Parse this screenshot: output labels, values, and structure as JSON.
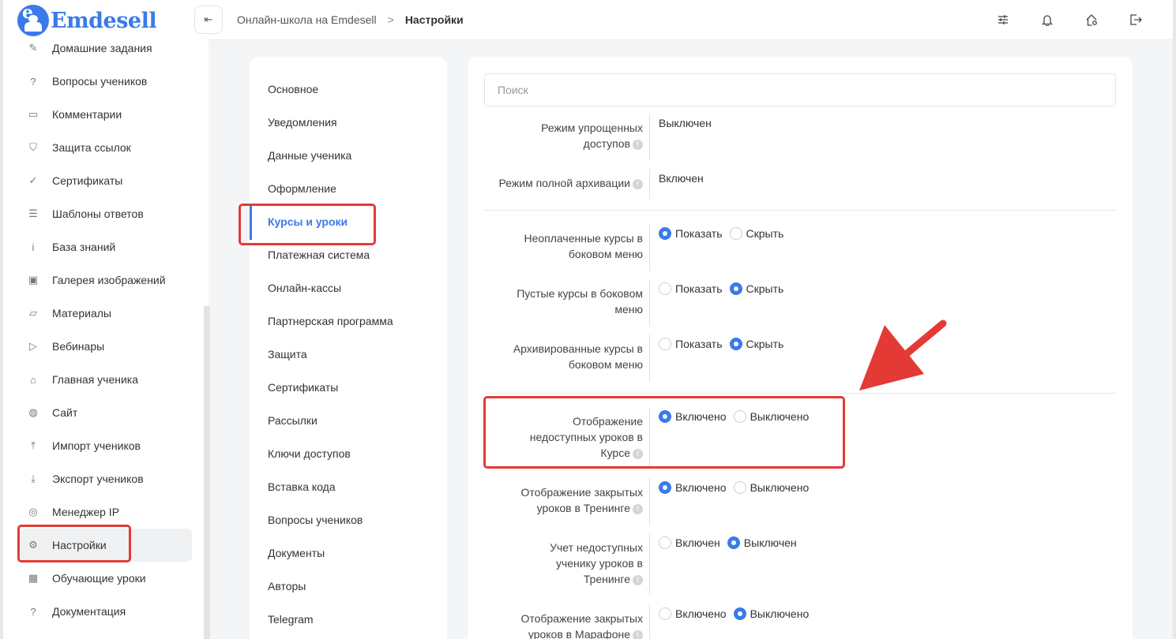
{
  "brand": {
    "letter": "e",
    "name": "Emdesell"
  },
  "sidebar": {
    "items": [
      {
        "label": "Домашние задания",
        "icon": "pencil-icon",
        "glyph": "✎"
      },
      {
        "label": "Вопросы учеников",
        "icon": "question-circle-icon",
        "glyph": "?"
      },
      {
        "label": "Комментарии",
        "icon": "comment-icon",
        "glyph": "▭"
      },
      {
        "label": "Защита ссылок",
        "icon": "shield-icon",
        "glyph": "⛉"
      },
      {
        "label": "Сертификаты",
        "icon": "badge-check-icon",
        "glyph": "✓"
      },
      {
        "label": "Шаблоны ответов",
        "icon": "list-icon",
        "glyph": "☰"
      },
      {
        "label": "База знаний",
        "icon": "info-circle-icon",
        "glyph": "i"
      },
      {
        "label": "Галерея изображений",
        "icon": "image-icon",
        "glyph": "▣"
      },
      {
        "label": "Материалы",
        "icon": "box-icon",
        "glyph": "▱"
      },
      {
        "label": "Вебинары",
        "icon": "play-icon",
        "glyph": "▷"
      },
      {
        "label": "Главная ученика",
        "icon": "home-gear-icon",
        "glyph": "⌂"
      },
      {
        "label": "Сайт",
        "icon": "globe-icon",
        "glyph": "◍"
      },
      {
        "label": "Импорт учеников",
        "icon": "upload-icon",
        "glyph": "⤒"
      },
      {
        "label": "Экспорт учеников",
        "icon": "download-icon",
        "glyph": "⤓"
      },
      {
        "label": "Менеджер IP",
        "icon": "target-icon",
        "glyph": "◎"
      },
      {
        "label": "Настройки",
        "icon": "gear-icon",
        "glyph": "⚙"
      },
      {
        "label": "Обучающие уроки",
        "icon": "film-icon",
        "glyph": "▦"
      },
      {
        "label": "Документация",
        "icon": "help-square-icon",
        "glyph": "?"
      }
    ]
  },
  "topbar": {
    "collapse_glyph": "⇤",
    "crumb_root": "Онлайн-школа на Emdesell",
    "crumb_sep": ">",
    "crumb_current": "Настройки",
    "icons": [
      "sliders-icon",
      "bell-icon",
      "home-settings-icon",
      "logout-icon"
    ]
  },
  "settings_menu": {
    "items": [
      "Основное",
      "Уведомления",
      "Данные ученика",
      "Оформление",
      "Курсы и уроки",
      "Платежная система",
      "Онлайн-кассы",
      "Партнерская программа",
      "Защита",
      "Сертификаты",
      "Рассылки",
      "Ключи доступов",
      "Вставка кода",
      "Вопросы учеников",
      "Документы",
      "Авторы",
      "Telegram"
    ],
    "active": "Курсы и уроки"
  },
  "main": {
    "search_placeholder": "Поиск",
    "rows": [
      {
        "label_lines": [
          "Режим упрощенных",
          "доступов"
        ],
        "info": true,
        "value": "Выключен"
      },
      {
        "label_lines": [
          "Режим полной архивации"
        ],
        "info": true,
        "value": "Включен"
      },
      {
        "label_lines": [
          "Неоплаченные курсы в",
          "боковом меню"
        ],
        "info": false,
        "options": [
          "Показать",
          "Скрыть"
        ],
        "selected": 0
      },
      {
        "label_lines": [
          "Пустые курсы в боковом",
          "меню"
        ],
        "info": false,
        "options": [
          "Показать",
          "Скрыть"
        ],
        "selected": 1
      },
      {
        "label_lines": [
          "Архивированные курсы в",
          "боковом меню"
        ],
        "info": false,
        "options": [
          "Показать",
          "Скрыть"
        ],
        "selected": 1
      },
      {
        "label_lines": [
          "Отображение",
          "недоступных уроков в",
          "Курсе"
        ],
        "info": true,
        "options": [
          "Включено",
          "Выключено"
        ],
        "selected": 0
      },
      {
        "label_lines": [
          "Отображение закрытых",
          "уроков в Тренинге"
        ],
        "info": true,
        "options": [
          "Включено",
          "Выключено"
        ],
        "selected": 0
      },
      {
        "label_lines": [
          "Учет недоступных",
          "ученику уроков в",
          "Тренинге"
        ],
        "info": true,
        "options": [
          "Включен",
          "Выключен"
        ],
        "selected": 1
      },
      {
        "label_lines": [
          "Отображение закрытых",
          "уроков в Марафоне"
        ],
        "info": true,
        "options": [
          "Включено",
          "Выключено"
        ],
        "selected": 1
      }
    ]
  },
  "colors": {
    "accent": "#3b7ae8",
    "highlight": "#e53935"
  }
}
